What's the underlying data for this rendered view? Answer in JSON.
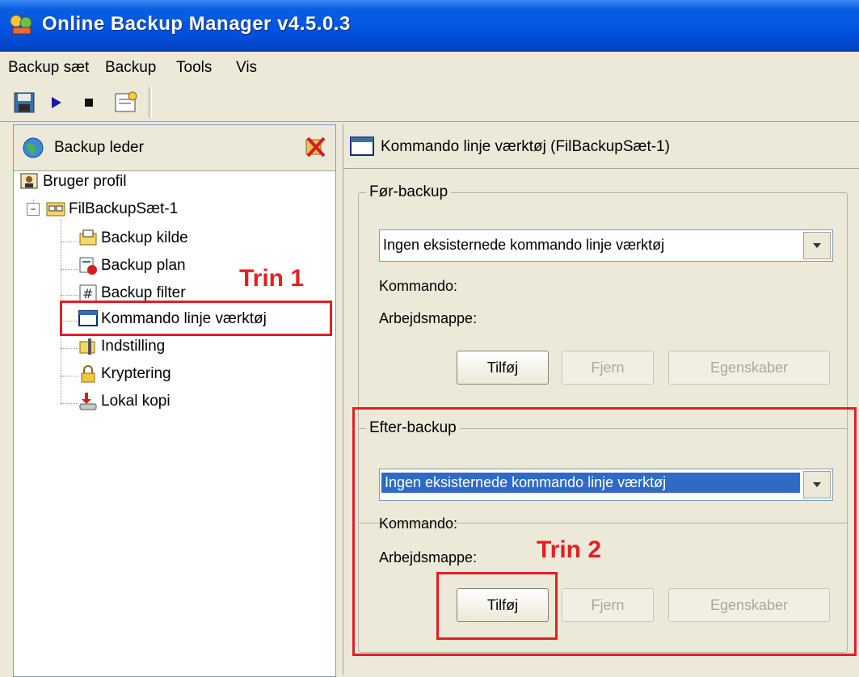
{
  "window": {
    "title": "Online Backup Manager v4.5.0.3"
  },
  "menu": [
    "Backup sæt",
    "Backup",
    "Tools",
    "Vis"
  ],
  "toolbar": [
    "save-icon",
    "play-icon",
    "stop-icon",
    "settings-icon"
  ],
  "left": {
    "header": "Backup leder",
    "tree": {
      "profile": "Bruger profil",
      "set": "FilBackupSæt-1",
      "items": [
        "Backup kilde",
        "Backup plan",
        "Backup filter",
        "Kommando linje værktøj",
        "Indstilling",
        "Kryptering",
        "Lokal kopi"
      ]
    }
  },
  "right": {
    "header": "Kommando linje værktøj (FilBackupSæt-1)",
    "pre": {
      "label": "Før-backup",
      "combo": "Ingen eksisternede kommando linje værktøj",
      "kommando": "Kommando:",
      "arbejdsmappe": "Arbejdsmappe:",
      "buttons": [
        "Tilføj",
        "Fjern",
        "Egenskaber"
      ]
    },
    "post": {
      "label": "Efter-backup",
      "combo": "Ingen eksisternede kommando linje værktøj",
      "kommando": "Kommando:",
      "arbejdsmappe": "Arbejdsmappe:",
      "buttons": [
        "Tilføj",
        "Fjern",
        "Egenskaber"
      ]
    }
  },
  "annotations": {
    "step1": "Trin 1",
    "step2": "Trin 2",
    "color": "#e31e24"
  }
}
